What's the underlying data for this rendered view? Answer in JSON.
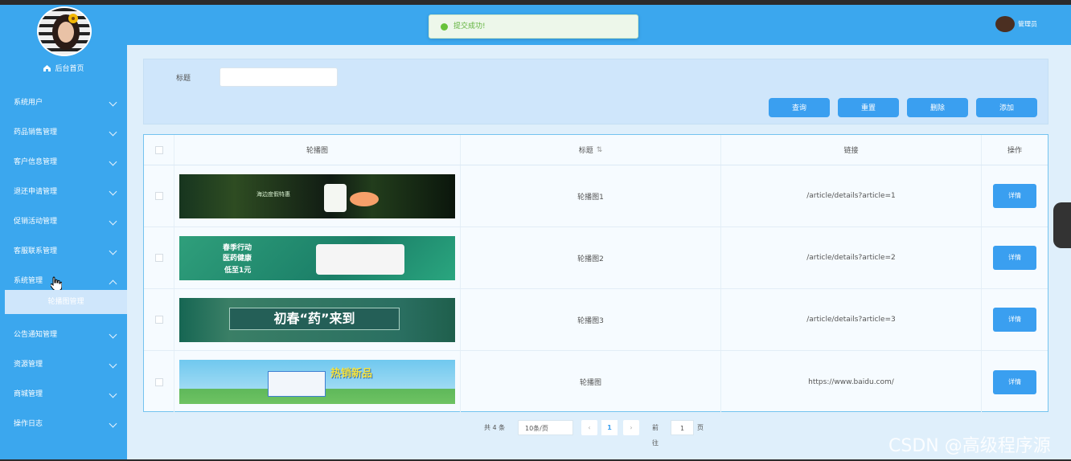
{
  "sidebar": {
    "home": "后台首页",
    "items": [
      "系统用户",
      "药品销售管理",
      "客户信息管理",
      "退还申请管理",
      "促销活动管理",
      "客服联系管理",
      "系统管理",
      "公告通知管理",
      "资源管理",
      "商城管理",
      "操作日志"
    ],
    "active_submenu": "轮播图管理"
  },
  "header": {
    "user_label": "管理员"
  },
  "toast": {
    "message": "提交成功!"
  },
  "search": {
    "label": "标题",
    "placeholder": "",
    "buttons": [
      "查询",
      "重置",
      "删除",
      "添加"
    ]
  },
  "table": {
    "headers": [
      "轮播图",
      "标题",
      "链接",
      "操作"
    ],
    "rows": [
      {
        "title": "轮播图1",
        "link": "/article/details?article=1",
        "action": "详情"
      },
      {
        "title": "轮播图2",
        "link": "/article/details?article=2",
        "action": "详情"
      },
      {
        "title": "轮播图3",
        "link": "/article/details?article=3",
        "action": "详情"
      },
      {
        "title": "轮播图",
        "link": "https://www.baidu.com/",
        "action": "详情"
      }
    ]
  },
  "banners": [
    {
      "text": "海边度假特惠"
    },
    {
      "text": "春季行动",
      "sub": "医药健康",
      "sub2": "低至1元"
    },
    {
      "text": "初春“药”来到"
    },
    {
      "text": "热销新品"
    }
  ],
  "pagination": {
    "total": "共 4 条",
    "page_size": "10条/页",
    "current": "1",
    "goto_label": "前往",
    "goto_value": "1",
    "page_suffix": "页"
  },
  "watermark": "CSDN @高级程序源",
  "colors": {
    "primary": "#3ba7ee",
    "button": "#3a9ff0",
    "success": "#67c23a"
  }
}
